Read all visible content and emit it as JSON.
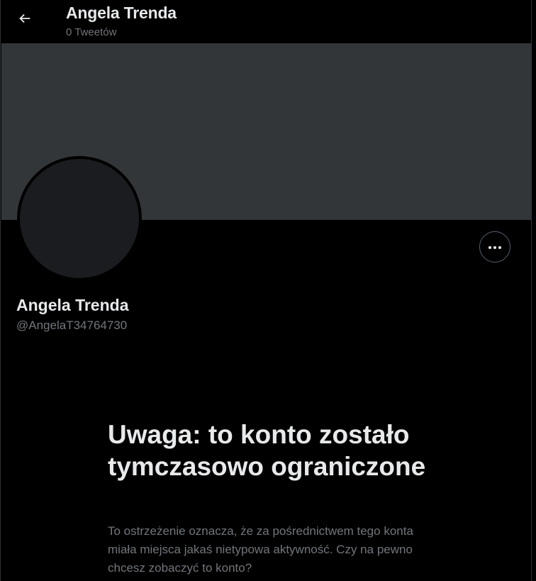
{
  "header": {
    "title": "Angela Trenda",
    "tweet_count": "0 Tweetów",
    "back_icon": "arrow-left-icon"
  },
  "profile": {
    "name": "Angela Trenda",
    "handle": "@AngelaT34764730",
    "more_icon": "more-horizontal-icon"
  },
  "warning": {
    "title": "Uwaga: to konto zostało tymczasowo ograniczone",
    "text": "To ostrzeżenie oznacza, że za pośrednictwem tego konta miała miejsca jakaś nietypowa aktywność. Czy na pewno chcesz zobaczyć to konto?"
  },
  "colors": {
    "background": "#000000",
    "banner": "#333639",
    "avatar": "#1a1c1f",
    "primary_text": "#e7e9ea",
    "secondary_text": "#71767b"
  }
}
